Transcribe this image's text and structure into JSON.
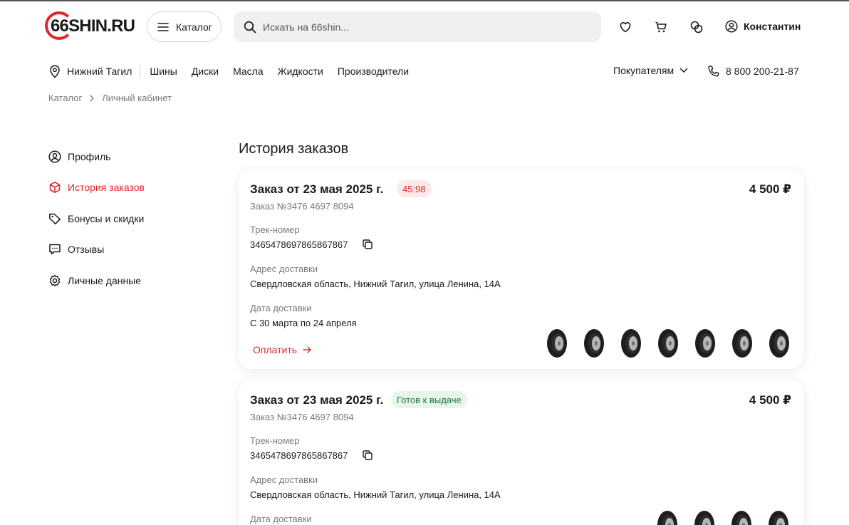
{
  "header": {
    "logo_text": "66SHIN.RU",
    "catalog_label": "Каталог",
    "search_placeholder": "Искать на 66shin...",
    "user_name": "Константин"
  },
  "nav": {
    "city": "Нижний Тагил",
    "items": [
      "Шины",
      "Диски",
      "Масла",
      "Жидкости",
      "Производители"
    ],
    "buyers_label": "Покупателям",
    "phone": "8 800 200-21-87"
  },
  "breadcrumb": [
    "Каталог",
    "Личный кабинет"
  ],
  "sidebar": {
    "items": [
      {
        "label": "Профиль",
        "icon": "user-circle-icon"
      },
      {
        "label": "История заказов",
        "icon": "box-icon"
      },
      {
        "label": "Бонусы и скидки",
        "icon": "tag-icon"
      },
      {
        "label": "Отзывы",
        "icon": "chat-icon"
      },
      {
        "label": "Личные данные",
        "icon": "gear-icon"
      }
    ]
  },
  "page_title": "История заказов",
  "orders": [
    {
      "title": "Заказ от 23 мая 2025 г.",
      "status": "45:98",
      "price": "4 500 ₽",
      "number": "Заказ №3476 4697 8094",
      "track_label": "Трек-номер",
      "track_value": "3465478697865867867",
      "address_label": "Адрес доставки",
      "address_value": "Свердловская область, Нижний Тагил, улица Ленина, 14А",
      "date_label": "Дата доставки",
      "date_value": "С 30 марта по 24 апреля",
      "action_label": "Оплатить"
    },
    {
      "title": "Заказ от 23 мая 2025 г.",
      "status": "Готов к выдаче",
      "price": "4 500 ₽",
      "number": "Заказ №3476 4697 8094",
      "track_label": "Трек-номер",
      "track_value": "3465478697865867867",
      "address_label": "Адрес доставки",
      "address_value": "Свердловская область, Нижний Тагил, улица Ленина, 14А",
      "date_label": "Дата доставки"
    }
  ],
  "colors": {
    "accent": "#e3262a",
    "ready": "#1b7b35"
  }
}
